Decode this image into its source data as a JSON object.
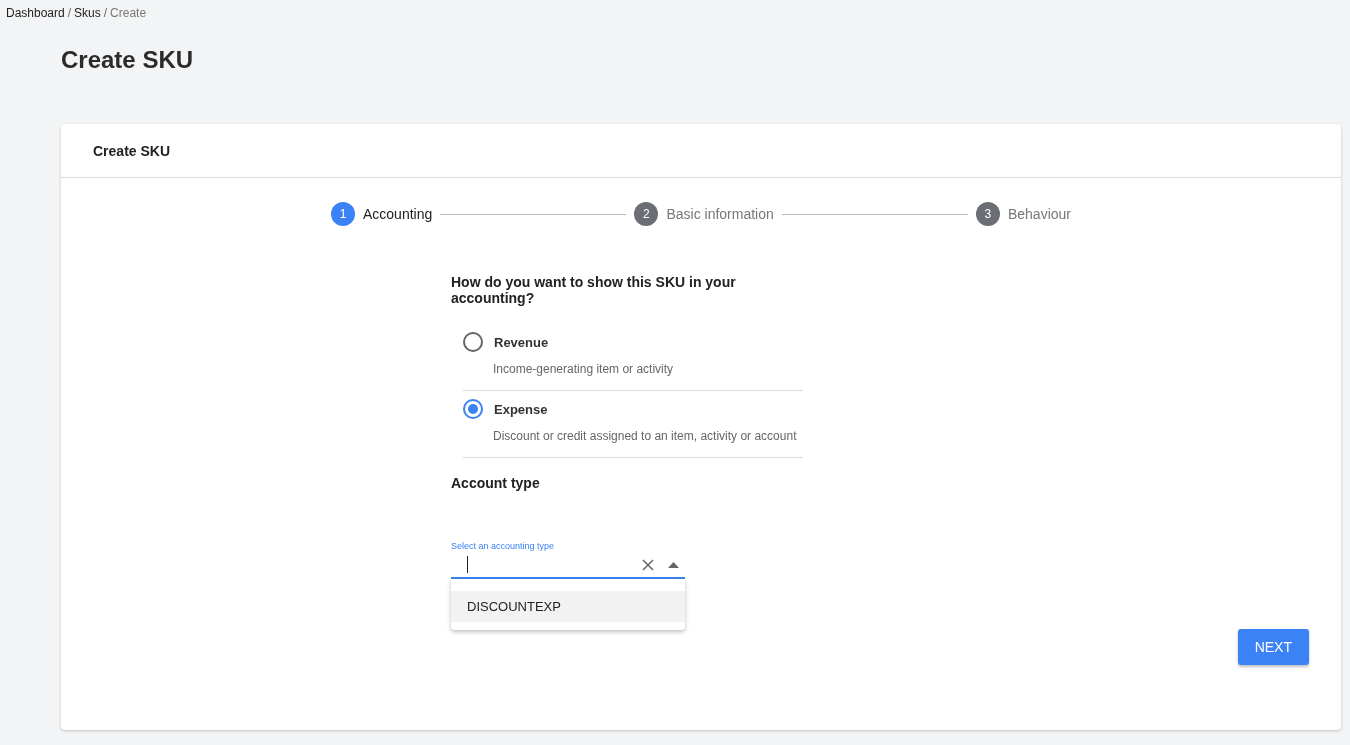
{
  "breadcrumb": [
    {
      "label": "Dashboard",
      "current": false
    },
    {
      "label": "Skus",
      "current": false
    },
    {
      "label": "Create",
      "current": true
    }
  ],
  "separator": "/",
  "page_title": "Create SKU",
  "card": {
    "title": "Create SKU",
    "steps": [
      {
        "number": "1",
        "label": "Accounting",
        "active": true
      },
      {
        "number": "2",
        "label": "Basic information",
        "active": false
      },
      {
        "number": "3",
        "label": "Behaviour",
        "active": false
      }
    ],
    "question": "How do you want to show this SKU in your accounting?",
    "options": [
      {
        "label": "Revenue",
        "description": "Income-generating item or activity",
        "selected": false
      },
      {
        "label": "Expense",
        "description": "Discount or credit assigned to an item, activity or account",
        "selected": true
      }
    ],
    "account_type": {
      "heading": "Account type",
      "field_label": "Select an accounting type",
      "focused": true,
      "expanded": true,
      "menu": [
        {
          "label": "DISCOUNTEXP",
          "highlighted": true
        }
      ]
    },
    "next_button": "NEXT"
  }
}
